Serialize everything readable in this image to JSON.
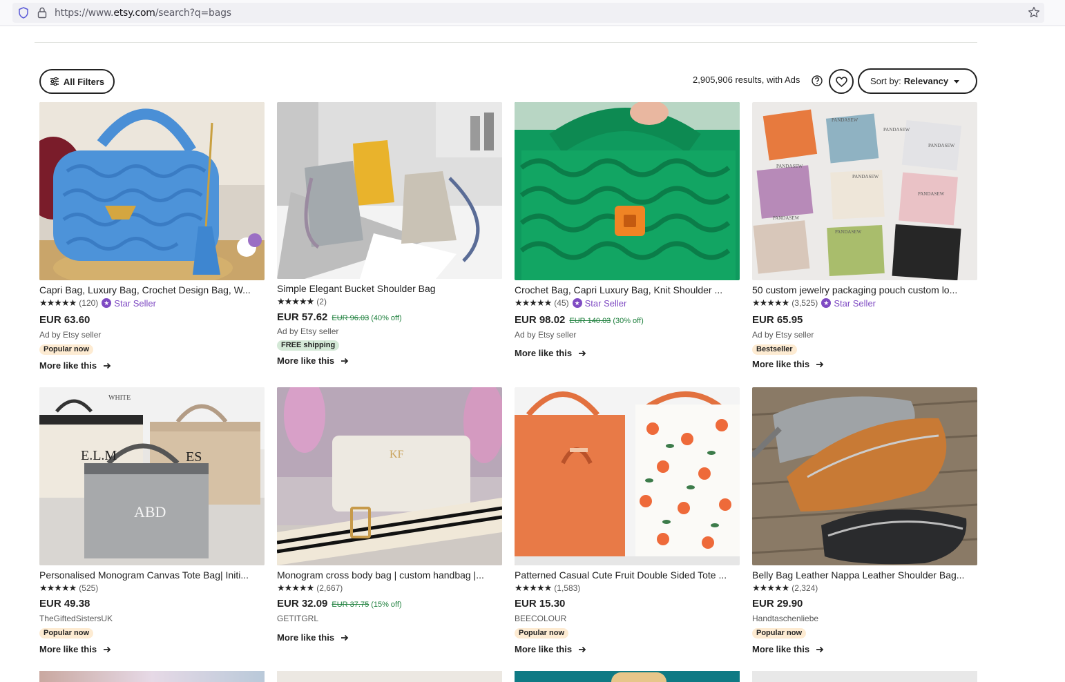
{
  "browser": {
    "url_prefix": "https://www.",
    "url_host": "etsy.com",
    "url_path": "/search?q=bags"
  },
  "toolbar": {
    "filters_label": "All Filters",
    "results_text": "2,905,906 results, with Ads",
    "sort_prefix": "Sort by:",
    "sort_value": "Relevancy"
  },
  "labels": {
    "more_like_this": "More like this",
    "star_seller": "Star Seller"
  },
  "products": [
    {
      "title": "Capri Bag, Luxury Bag, Crochet Design Bag, W...",
      "reviews": "(120)",
      "star_seller": true,
      "price": "EUR 63.60",
      "original_price": "",
      "discount": "",
      "seller": "Ad by Etsy seller",
      "tag": "Popular now",
      "tag_type": "popular"
    },
    {
      "title": "Simple Elegant Bucket Shoulder Bag",
      "reviews": "(2)",
      "star_seller": false,
      "price": "EUR 57.62",
      "original_price": "EUR 96.03",
      "discount": "(40% off)",
      "seller": "Ad by Etsy seller",
      "tag": "FREE shipping",
      "tag_type": "ship"
    },
    {
      "title": "Crochet Bag, Capri Luxury Bag, Knit Shoulder ...",
      "reviews": "(45)",
      "star_seller": true,
      "price": "EUR 98.02",
      "original_price": "EUR 140.03",
      "discount": "(30% off)",
      "seller": "Ad by Etsy seller",
      "tag": "",
      "tag_type": ""
    },
    {
      "title": "50 custom jewelry packaging pouch custom lo...",
      "reviews": "(3,525)",
      "star_seller": true,
      "price": "EUR 65.95",
      "original_price": "",
      "discount": "",
      "seller": "Ad by Etsy seller",
      "tag": "Bestseller",
      "tag_type": "best"
    },
    {
      "title": "Personalised Monogram Canvas Tote Bag| Initi...",
      "reviews": "(525)",
      "star_seller": false,
      "price": "EUR 49.38",
      "original_price": "",
      "discount": "",
      "seller": "TheGiftedSistersUK",
      "tag": "Popular now",
      "tag_type": "popular"
    },
    {
      "title": "Monogram cross body bag | custom handbag |...",
      "reviews": "(2,667)",
      "star_seller": false,
      "price": "EUR 32.09",
      "original_price": "EUR 37.75",
      "discount": "(15% off)",
      "seller": "GETITGRL",
      "tag": "",
      "tag_type": ""
    },
    {
      "title": "Patterned Casual Cute Fruit Double Sided Tote ...",
      "reviews": "(1,583)",
      "star_seller": false,
      "price": "EUR 15.30",
      "original_price": "",
      "discount": "",
      "seller": "BEECOLOUR",
      "tag": "Popular now",
      "tag_type": "popular"
    },
    {
      "title": "Belly Bag Leather Nappa Leather Shoulder Bag...",
      "reviews": "(2,324)",
      "star_seller": false,
      "price": "EUR 29.90",
      "original_price": "",
      "discount": "",
      "seller": "Handtaschenliebe",
      "tag": "Popular now",
      "tag_type": "popular"
    }
  ],
  "image_text": {
    "p5_brand": "WHITE",
    "p5_mono1": "E.L.M",
    "p5_mono2": "ES",
    "p5_mono3": "ABD",
    "p6_mono": "KF",
    "p4_brand": "PANDASEW"
  },
  "colors": {
    "accent": "#7f4bc3",
    "discount": "#1d7f3c",
    "tag_popular": "#fdebd2",
    "tag_ship": "#d4e9d7"
  }
}
